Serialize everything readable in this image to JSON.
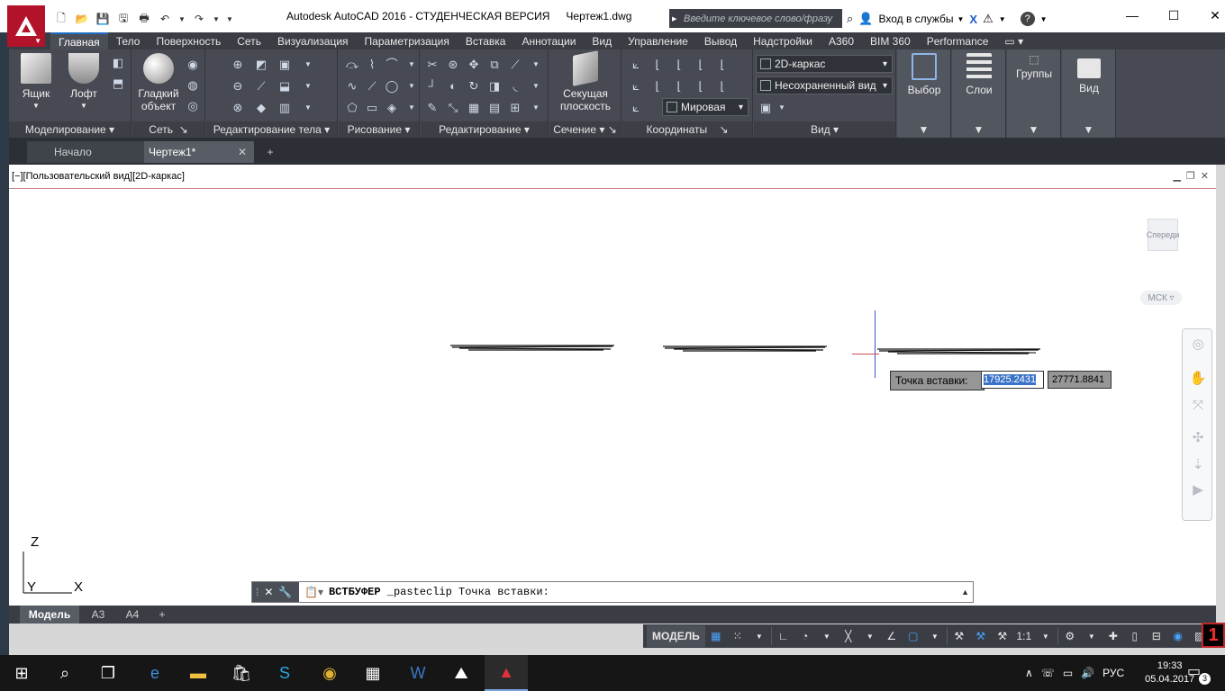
{
  "app": {
    "title": "Autodesk AutoCAD 2016 - СТУДЕНЧЕСКАЯ ВЕРСИЯ",
    "filename": "Чертеж1.dwg",
    "search_placeholder": "Введите ключевое слово/фразу",
    "login_label": "Вход в службы",
    "help": "?"
  },
  "ribbon_tabs": [
    "Главная",
    "Тело",
    "Поверхность",
    "Сеть",
    "Визуализация",
    "Параметризация",
    "Вставка",
    "Аннотации",
    "Вид",
    "Управление",
    "Вывод",
    "Надстройки",
    "A360",
    "BIM 360",
    "Performance"
  ],
  "ribbon": {
    "box_label": "Ящик",
    "loft_label": "Лофт",
    "smooth_label_1": "Гладкий",
    "smooth_label_2": "объект",
    "section_plane_1": "Секущая",
    "section_plane_2": "плоскость",
    "visual_style": "2D-каркас",
    "view_saved": "Несохраненный вид",
    "ucs_world": "Мировая",
    "selection_label": "Выбор",
    "layers_label": "Слои",
    "groups_label": "Группы",
    "view_label": "Вид",
    "panels": {
      "modeling": "Моделирование",
      "mesh": "Сеть",
      "solid_edit": "Редактирование тела",
      "draw": "Рисование",
      "modify": "Редактирование",
      "section": "Сечение",
      "coordinates": "Координаты",
      "view": "Вид"
    }
  },
  "file_tabs": {
    "start": "Начало",
    "drawing": "Чертеж1*",
    "new": "+"
  },
  "viewport": {
    "label": "[−][Пользовательский вид][2D-каркас]",
    "viewcube_face": "Спереди",
    "ucs_name": "МСК",
    "axis_z": "Z",
    "axis_y": "Y",
    "axis_x": "X"
  },
  "dynamic_input": {
    "prompt": "Точка вставки:",
    "x_value": "17925.2431",
    "y_value": "27771.8841"
  },
  "command_line": {
    "command": "ВСТБУФЕР",
    "text": "_pasteclip Точка вставки:"
  },
  "layout_tabs": [
    "Модель",
    "A3",
    "A4",
    "+"
  ],
  "status": {
    "model": "МОДЕЛЬ",
    "scale": "1:1"
  },
  "taskbar": {
    "language": "РУС",
    "time": "19:33",
    "date": "05.04.2017",
    "notifications": "3"
  },
  "colors": {
    "ribbon_bg": "#474a52",
    "accent_red": "#b3132a",
    "selection_blue": "#3a72c8"
  }
}
